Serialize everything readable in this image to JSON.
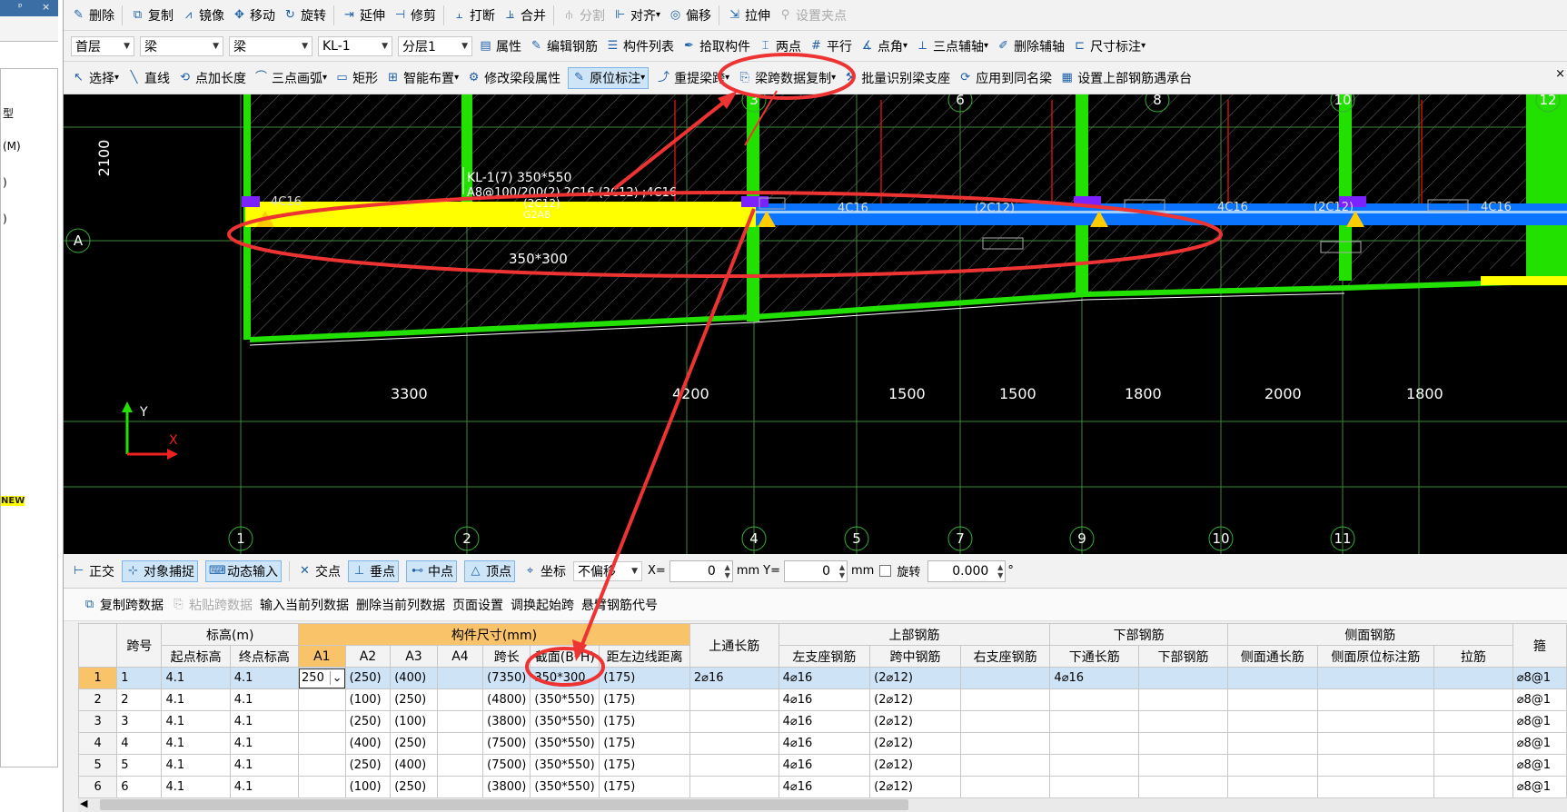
{
  "left_panel": {
    "pin": "ᵖ",
    "close": "×",
    "items": [
      "型",
      "(M)",
      ")",
      ")"
    ],
    "new_badge": "NEW"
  },
  "toolbar1": [
    {
      "icon": "pencil-delete",
      "label": "删除",
      "enabled": true
    },
    {
      "icon": "copy",
      "label": "复制",
      "enabled": true
    },
    {
      "icon": "mirror",
      "label": "镜像",
      "enabled": true
    },
    {
      "icon": "move",
      "label": "移动",
      "enabled": true
    },
    {
      "icon": "rotate",
      "label": "旋转",
      "enabled": true
    },
    {
      "icon": "extend",
      "label": "延伸",
      "enabled": true
    },
    {
      "icon": "trim",
      "label": "修剪",
      "enabled": true
    },
    {
      "icon": "break",
      "label": "打断",
      "enabled": true
    },
    {
      "icon": "merge",
      "label": "合并",
      "enabled": true
    },
    {
      "icon": "split",
      "label": "分割",
      "enabled": false
    },
    {
      "icon": "align",
      "label": "对齐",
      "enabled": true,
      "dropdown": true
    },
    {
      "icon": "offset",
      "label": "偏移",
      "enabled": true
    },
    {
      "icon": "stretch",
      "label": "拉伸",
      "enabled": true
    },
    {
      "icon": "set-grip",
      "label": "设置夹点",
      "enabled": false
    }
  ],
  "toolbar2": {
    "combos": [
      {
        "value": "首层"
      },
      {
        "value": "梁"
      },
      {
        "value": "梁"
      },
      {
        "value": "KL-1"
      },
      {
        "value": "分层1"
      }
    ],
    "buttons": [
      {
        "icon": "properties",
        "label": "属性"
      },
      {
        "icon": "edit-rebar",
        "label": "编辑钢筋"
      },
      {
        "icon": "component-list",
        "label": "构件列表"
      },
      {
        "icon": "pick",
        "label": "拾取构件"
      },
      {
        "icon": "two-point",
        "label": "两点"
      },
      {
        "icon": "parallel",
        "label": "平行"
      },
      {
        "icon": "point-angle",
        "label": "点角",
        "dropdown": true
      },
      {
        "icon": "three-point-axis",
        "label": "三点辅轴",
        "dropdown": true
      },
      {
        "icon": "delete-axis",
        "label": "删除辅轴"
      },
      {
        "icon": "dimension",
        "label": "尺寸标注",
        "dropdown": true
      }
    ]
  },
  "toolbar3": [
    {
      "icon": "select",
      "label": "选择",
      "dropdown": true
    },
    {
      "icon": "line",
      "label": "直线"
    },
    {
      "icon": "point-length",
      "label": "点加长度"
    },
    {
      "icon": "arc",
      "label": "三点画弧",
      "dropdown": true
    },
    {
      "icon": "rect",
      "label": "矩形"
    },
    {
      "icon": "smart",
      "label": "智能布置",
      "dropdown": true
    },
    {
      "icon": "modify-span",
      "label": "修改梁段属性"
    },
    {
      "icon": "in-place",
      "label": "原位标注",
      "dropdown": true,
      "pressed": true
    },
    {
      "icon": "re-span",
      "label": "重提梁跨",
      "dropdown": true
    },
    {
      "icon": "span-copy",
      "label": "梁跨数据复制",
      "dropdown": true
    },
    {
      "icon": "batch",
      "label": "批量识别梁支座"
    },
    {
      "icon": "apply-same",
      "label": "应用到同名梁"
    },
    {
      "icon": "top-rebar",
      "label": "设置上部钢筋遇承台"
    }
  ],
  "canvas": {
    "axis_top": [
      "3",
      "6",
      "8",
      "10",
      "12"
    ],
    "axis_bottom": [
      "1",
      "2",
      "4",
      "5",
      "7",
      "9",
      "10",
      "11"
    ],
    "axis_left": "A",
    "dim_left": "2100",
    "dims": [
      "3300",
      "4200",
      "1500",
      "1500",
      "1800",
      "2000",
      "1800"
    ],
    "beam_label": "KL-1(7) 350*550",
    "beam_spec1": "A8@100/200(2) 2C16 (2C12) ;4C16",
    "beam_spec2": "(2C12)",
    "beam_spec3": "G2A8",
    "section_label": "350*300",
    "rebar_labels": [
      "4C16",
      "4C16",
      "(2C12)",
      "4C16",
      "(2C12)",
      "4C16"
    ],
    "ucs_y": "Y",
    "ucs_x": "X"
  },
  "statusbar": {
    "ortho": "正交",
    "snap": "对象捕捉",
    "dyn": "动态输入",
    "intersect": "交点",
    "perp": "垂点",
    "mid": "中点",
    "vertex": "顶点",
    "coord": "坐标",
    "offset_mode": "不偏移",
    "x_label": "X=",
    "x_value": "0",
    "y_label": "Y=",
    "y_value": "0",
    "unit": "mm",
    "rotate_label": "旋转",
    "rotate_value": "0.000",
    "deg": "°"
  },
  "table_toolbar": [
    "复制跨数据",
    "粘贴跨数据",
    "输入当前列数据",
    "删除当前列数据",
    "页面设置",
    "调换起始跨",
    "悬臂钢筋代号"
  ],
  "table": {
    "h_span": "跨号",
    "h_elev": "标高(m)",
    "h_size": "构件尺寸(mm)",
    "h_top_through": "上通长筋",
    "h_top": "上部钢筋",
    "h_bottom": "下部钢筋",
    "h_side": "侧面钢筋",
    "h_stirrup": "箍",
    "sub": [
      "起点标高",
      "终点标高",
      "A1",
      "A2",
      "A3",
      "A4",
      "跨长",
      "截面(B*H)",
      "距左边线距离",
      "左支座钢筋",
      "跨中钢筋",
      "右支座钢筋",
      "下通长筋",
      "下部钢筋",
      "侧面通长筋",
      "侧面原位标注筋",
      "拉筋"
    ],
    "rows": [
      [
        "1",
        "1",
        "4.1",
        "4.1",
        "250",
        "(250)",
        "(400)",
        "",
        "(7350)",
        "350*300",
        "(175)",
        "2⌀16",
        "4⌀16",
        "(2⌀12)",
        "",
        "4⌀16",
        "",
        "",
        "",
        "",
        "⌀8@1"
      ],
      [
        "2",
        "2",
        "4.1",
        "4.1",
        "",
        "(100)",
        "(250)",
        "",
        "(4800)",
        "(350*550)",
        "(175)",
        "",
        "4⌀16",
        "(2⌀12)",
        "",
        "",
        "",
        "",
        "",
        "",
        "⌀8@1"
      ],
      [
        "3",
        "3",
        "4.1",
        "4.1",
        "",
        "(250)",
        "(100)",
        "",
        "(3800)",
        "(350*550)",
        "(175)",
        "",
        "4⌀16",
        "(2⌀12)",
        "",
        "",
        "",
        "",
        "",
        "",
        "⌀8@1"
      ],
      [
        "4",
        "4",
        "4.1",
        "4.1",
        "",
        "(400)",
        "(250)",
        "",
        "(7500)",
        "(350*550)",
        "(175)",
        "",
        "4⌀16",
        "(2⌀12)",
        "",
        "",
        "",
        "",
        "",
        "",
        "⌀8@1"
      ],
      [
        "5",
        "5",
        "4.1",
        "4.1",
        "",
        "(250)",
        "(400)",
        "",
        "(7500)",
        "(350*550)",
        "(175)",
        "",
        "4⌀16",
        "(2⌀12)",
        "",
        "",
        "",
        "",
        "",
        "",
        "⌀8@1"
      ],
      [
        "6",
        "6",
        "4.1",
        "4.1",
        "",
        "(100)",
        "(250)",
        "",
        "(3800)",
        "(350*550)",
        "(175)",
        "",
        "4⌀16",
        "(2⌀12)",
        "",
        "",
        "",
        "",
        "",
        "",
        "⌀8@1"
      ]
    ]
  },
  "colors": {
    "beam_yellow": "#ffff00",
    "beam_blue": "#0a74ff",
    "wall_green": "#22e000",
    "annot_red": "#ee3333",
    "axis": "#35b035"
  }
}
